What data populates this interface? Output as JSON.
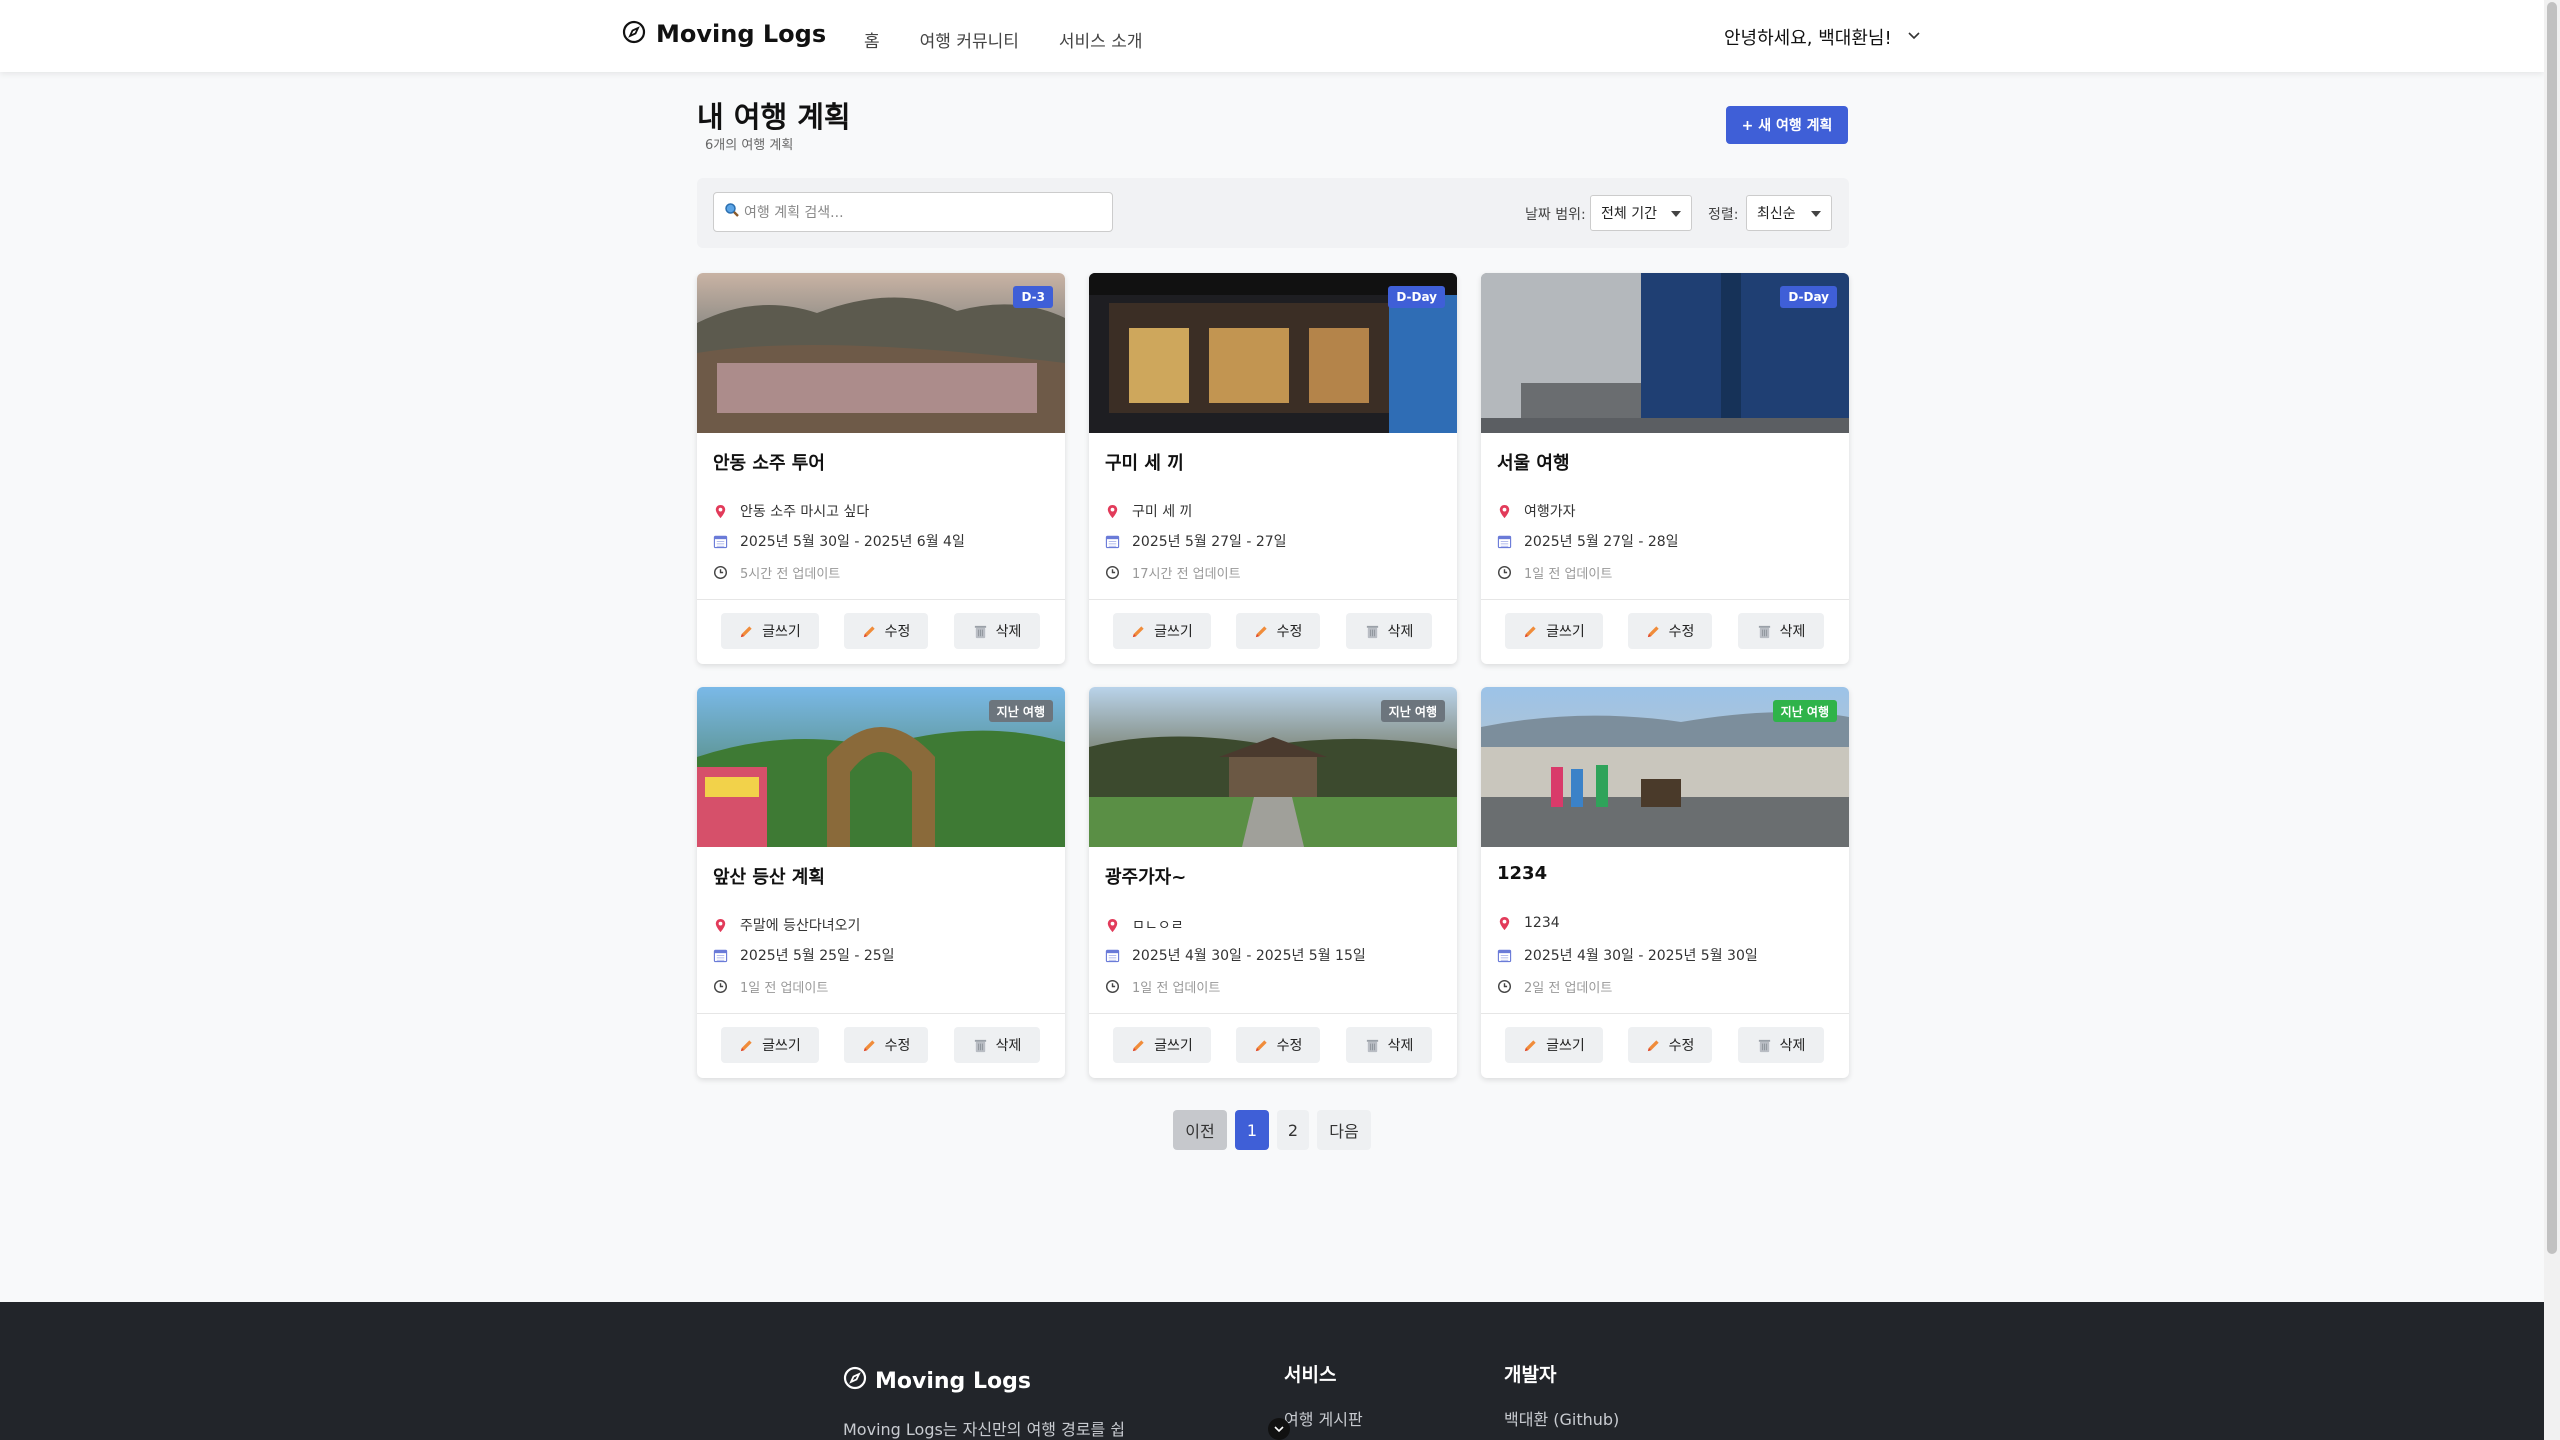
{
  "header": {
    "brand": "Moving Logs",
    "nav": [
      "홈",
      "여행 커뮤니티",
      "서비스 소개"
    ],
    "greeting": "안녕하세요, 백대환님!"
  },
  "page": {
    "title": "내 여행 계획",
    "subtitle": "6개의 여행 계획",
    "new_button": "+ 새 여행 계획"
  },
  "filters": {
    "search_placeholder": "여행 계획 검색...",
    "date_label": "날짜 범위:",
    "date_value": "전체 기간",
    "sort_label": "정렬:",
    "sort_value": "최신순"
  },
  "actions": {
    "write": "글쓰기",
    "edit": "수정",
    "delete": "삭제"
  },
  "cards": [
    {
      "title": "안동 소주 투어",
      "badge": "D-3",
      "badge_color": "#3f5fd7",
      "desc": "안동 소주 마시고 싶다",
      "dates": "2025년 5월 30일 - 2025년 6월 4일",
      "updated": "5시간 전 업데이트"
    },
    {
      "title": "구미 세 끼",
      "badge": "D-Day",
      "badge_color": "#3f5fd7",
      "desc": "구미 세 끼",
      "dates": "2025년 5월 27일 - 27일",
      "updated": "17시간 전 업데이트"
    },
    {
      "title": "서울 여행",
      "badge": "D-Day",
      "badge_color": "#3f5fd7",
      "desc": "여행가자",
      "dates": "2025년 5월 27일 - 28일",
      "updated": "1일 전 업데이트"
    },
    {
      "title": "앞산 등산 계획",
      "badge": "지난 여행",
      "badge_color": "#6c757d",
      "desc": "주말에 등산다녀오기",
      "dates": "2025년 5월 25일 - 25일",
      "updated": "1일 전 업데이트"
    },
    {
      "title": "광주가자~",
      "badge": "지난 여행",
      "badge_color": "#6c757d",
      "desc": "ㅁㄴㅇㄹ",
      "dates": "2025년 4월 30일 - 2025년 5월 15일",
      "updated": "1일 전 업데이트"
    },
    {
      "title": "1234",
      "badge": "지난 여행",
      "badge_color": "#2fb34a",
      "desc": "1234",
      "dates": "2025년 4월 30일 - 2025년 5월 30일",
      "updated": "2일 전 업데이트"
    }
  ],
  "pagination": {
    "prev": "이전",
    "pages": [
      "1",
      "2"
    ],
    "next": "다음",
    "active_color": "#3f5fd7"
  },
  "footer": {
    "brand": "Moving Logs",
    "desc": "Moving Logs는 자신만의 여행 경로를 쉽",
    "col1_title": "서비스",
    "col1_link": "여행 게시판",
    "col2_title": "개발자",
    "col2_link": "백대환 (Github)"
  }
}
